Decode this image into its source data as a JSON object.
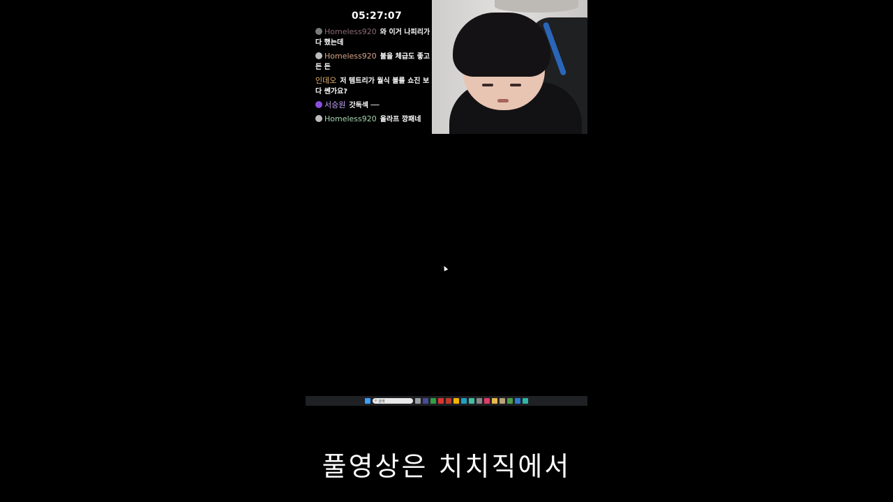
{
  "overlay": {
    "clock": "05:27:07"
  },
  "chat": {
    "messages": [
      {
        "nick": "Homeless920",
        "text": "와 이거 나피리가 다 했는데",
        "nick_color": "#8c6a78",
        "badge_color": "#7a7a7a"
      },
      {
        "nick": "Homeless920",
        "text": "불을 체급도 좋고 든 든",
        "nick_color": "#d8a58a",
        "badge_color": "#bdbdbd"
      },
      {
        "nick": "인데오",
        "text": "저 템트리가 월식 볼를 쇼진 보다 쎈가요?",
        "nick_color": "#e3b26a",
        "badge_color": ""
      },
      {
        "nick": "서승원",
        "text": "갓독섹 ──",
        "nick_color": "#c9a7ff",
        "badge_color": "#8a4fe0"
      },
      {
        "nick": "Homeless920",
        "text": "올라프 깡패네",
        "nick_color": "#a6d8b0",
        "badge_color": "#bdbdbd"
      }
    ]
  },
  "taskbar": {
    "search_placeholder": "검색",
    "icons": [
      {
        "name": "windows-start-icon",
        "color": "#3aa0ff"
      },
      {
        "name": "task-view-icon",
        "color": "#9aa0a6"
      },
      {
        "name": "app-icon-m",
        "color": "#4a4a9a"
      },
      {
        "name": "app-icon-n",
        "color": "#2ea043"
      },
      {
        "name": "app-icon-red",
        "color": "#d33"
      },
      {
        "name": "app-icon-box",
        "color": "#c0392b"
      },
      {
        "name": "chrome-icon",
        "color": "#f4b400"
      },
      {
        "name": "edge-icon",
        "color": "#1ea1c1"
      },
      {
        "name": "app-icon-teal",
        "color": "#3fbfa0"
      },
      {
        "name": "app-icon-mic",
        "color": "#888"
      },
      {
        "name": "app-icon-pink",
        "color": "#e23a6a"
      },
      {
        "name": "folder-icon",
        "color": "#e8b84a"
      },
      {
        "name": "app-icon-grid",
        "color": "#b9a37a"
      },
      {
        "name": "app-icon-green",
        "color": "#4c9e4c"
      },
      {
        "name": "photoshop-icon",
        "color": "#2b7bd0"
      },
      {
        "name": "app-icon-cyan",
        "color": "#2fb6a6"
      }
    ]
  },
  "caption": {
    "text": "풀영상은 치치직에서"
  }
}
